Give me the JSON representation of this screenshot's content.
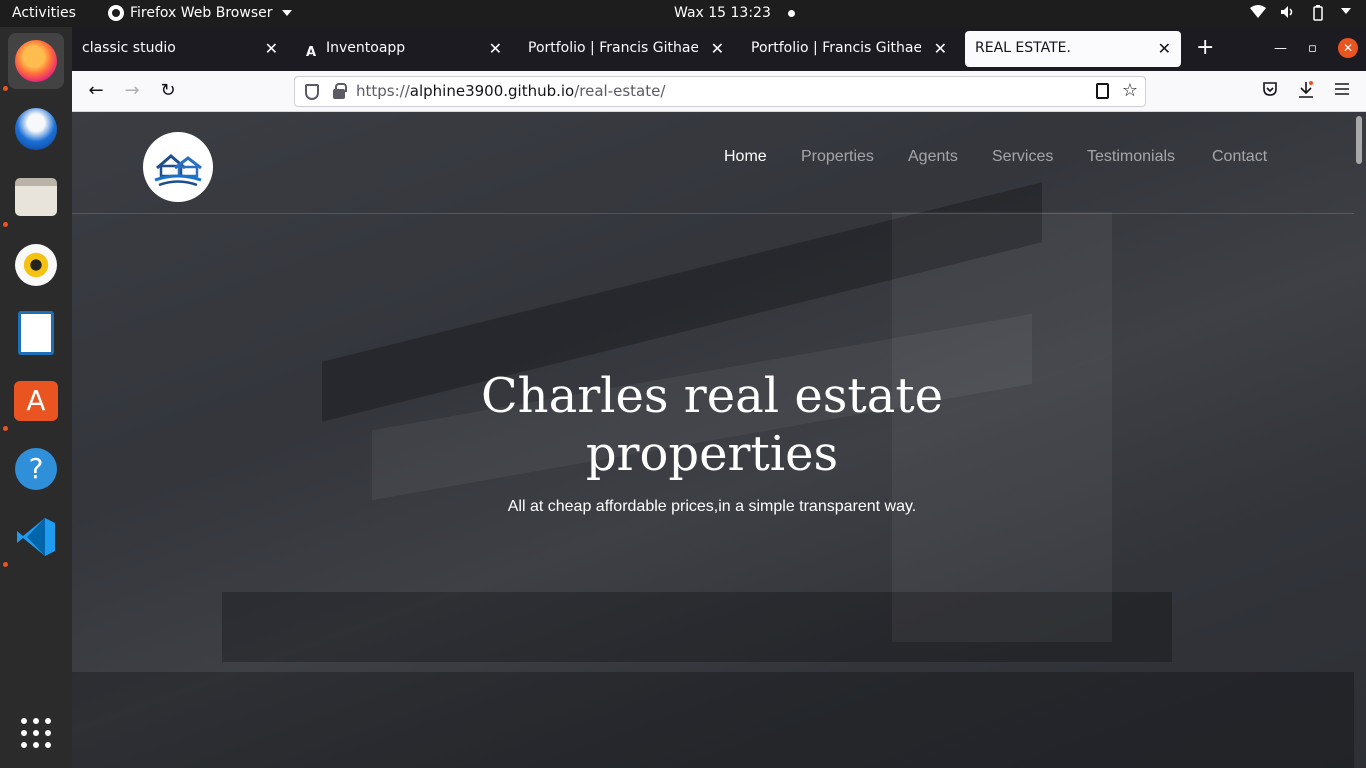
{
  "system": {
    "activities": "Activities",
    "app_name": "Firefox Web Browser",
    "clock": "Wax 15  13:23"
  },
  "browser": {
    "tabs": [
      {
        "label": "classic studio",
        "favicon": ""
      },
      {
        "label": "Inventoapp",
        "favicon": "A"
      },
      {
        "label": "Portfolio | Francis Githae",
        "favicon": ""
      },
      {
        "label": "Portfolio | Francis Githae",
        "favicon": ""
      },
      {
        "label": "REAL ESTATE.",
        "favicon": ""
      }
    ],
    "active_tab": 4,
    "url_prefix": "https://",
    "url_host": "alphine3900.github.io",
    "url_path": "/real-estate/"
  },
  "dock": {
    "items": [
      "firefox-icon",
      "thunderbird-icon",
      "files-icon",
      "rhythmbox-icon",
      "libreoffice-writer-icon",
      "software-center-icon",
      "help-icon",
      "vscode-icon",
      "app-grid-icon"
    ]
  },
  "site": {
    "nav": [
      "Home",
      "Properties",
      "Agents",
      "Services",
      "Testimonials",
      "Contact"
    ],
    "active_nav": "Home",
    "hero_title_line1": "Charles real estate",
    "hero_title_line2": "properties",
    "hero_subtitle": "All at cheap affordable prices,in a simple transparent way."
  },
  "colors": {
    "accent": "#e95420",
    "overlay": "#2c2e34"
  }
}
